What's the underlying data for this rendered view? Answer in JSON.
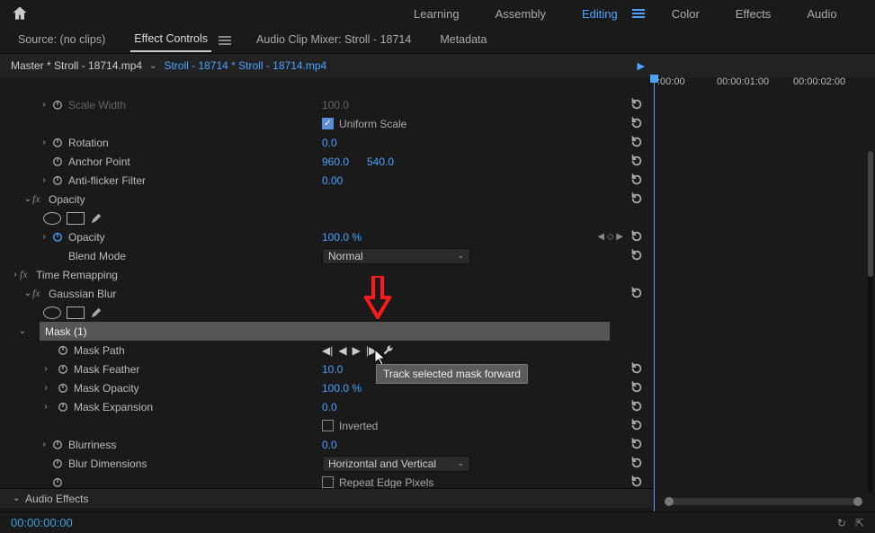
{
  "workspace": {
    "tabs": [
      "Learning",
      "Assembly",
      "Editing",
      "Color",
      "Effects",
      "Audio"
    ],
    "active": "Editing"
  },
  "panels": {
    "tabs": [
      "Source: (no clips)",
      "Effect Controls",
      "Audio Clip Mixer: Stroll - 18714",
      "Metadata"
    ],
    "active": "Effect Controls"
  },
  "master": {
    "left": "Master * Stroll - 18714.mp4",
    "right": "Stroll - 18714 * Stroll - 18714.mp4"
  },
  "timeline": {
    "t0": ":00:00",
    "t1": "00:00:01:00",
    "t2": "00:00:02:00"
  },
  "fx": {
    "scale_width": {
      "label": "Scale Width",
      "value": "100.0"
    },
    "uniform_scale": {
      "label": "Uniform Scale"
    },
    "rotation": {
      "label": "Rotation",
      "value": "0.0"
    },
    "anchor": {
      "label": "Anchor Point",
      "x": "960.0",
      "y": "540.0"
    },
    "antiflicker": {
      "label": "Anti-flicker Filter",
      "value": "0.00"
    },
    "opacity_group": {
      "label": "Opacity"
    },
    "opacity": {
      "label": "Opacity",
      "value": "100.0 %"
    },
    "blend": {
      "label": "Blend Mode",
      "value": "Normal"
    },
    "timeremap": {
      "label": "Time Remapping"
    },
    "gblur": {
      "label": "Gaussian Blur"
    },
    "mask": {
      "label": "Mask (1)"
    },
    "maskpath": {
      "label": "Mask Path"
    },
    "maskfeather": {
      "label": "Mask Feather",
      "value": "10.0"
    },
    "maskopacity": {
      "label": "Mask Opacity",
      "value": "100.0 %"
    },
    "maskexp": {
      "label": "Mask Expansion",
      "value": "0.0"
    },
    "inverted": {
      "label": "Inverted"
    },
    "blurriness": {
      "label": "Blurriness",
      "value": "0.0"
    },
    "blurdim": {
      "label": "Blur Dimensions",
      "value": "Horizontal and Vertical"
    },
    "repeat_edge": {
      "label": "Repeat Edge Pixels"
    },
    "audio": {
      "label": "Audio Effects"
    }
  },
  "tooltip": "Track selected mask forward",
  "timecode": "00:00:00:00"
}
